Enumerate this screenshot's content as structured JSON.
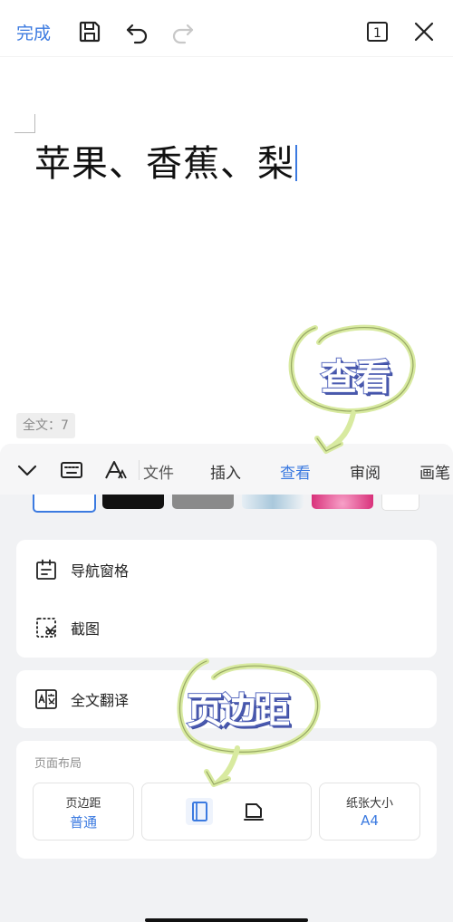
{
  "topbar": {
    "done_label": "完成",
    "icons": [
      "save-icon",
      "undo-icon",
      "redo-icon",
      "page-count-icon",
      "close-icon"
    ],
    "page_count": "1"
  },
  "document": {
    "text": "苹果、香蕉、梨",
    "word_count": "全文：7"
  },
  "annotations": {
    "view_sticker": "查看",
    "margin_sticker": "页边距"
  },
  "toolbar": {
    "icons": [
      "collapse-chevron-icon",
      "keyboard-icon",
      "text-style-icon"
    ],
    "tabs": [
      {
        "label": "文件",
        "visible_text": "文件"
      },
      {
        "label": "插入"
      },
      {
        "label": "查看",
        "active": true
      },
      {
        "label": "审阅"
      },
      {
        "label": "画笔",
        "visible_text": "画笔"
      }
    ]
  },
  "menu": {
    "items": [
      {
        "label": "导航窗格",
        "icon": "navigation-pane-icon"
      },
      {
        "label": "截图",
        "icon": "screenshot-icon"
      },
      {
        "label": "全文翻译",
        "icon": "translate-icon"
      }
    ]
  },
  "page_layout": {
    "title": "页面布局",
    "margin_label": "页边距",
    "margin_value": "普通",
    "orientation_options": [
      "portrait-icon",
      "landscape-icon"
    ],
    "selected_orientation": "portrait",
    "paper_label": "纸张大小",
    "paper_value": "A4"
  },
  "colors": {
    "accent": "#3b7ae0",
    "panel_bg": "#f1f2f4",
    "sticker_outline": "#5a6cc0",
    "highlight_circle": "#d8eaa0"
  }
}
